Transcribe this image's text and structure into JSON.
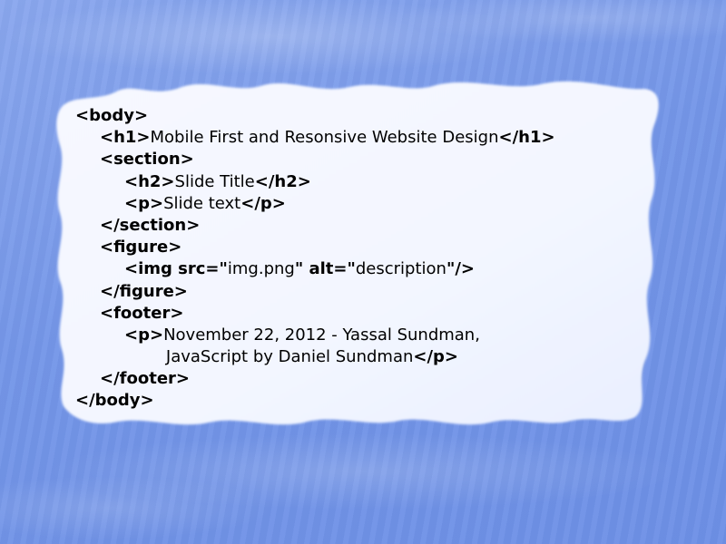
{
  "background": {
    "color": "#7a9ae9",
    "paper_color": "#f4f7ff"
  },
  "code_lines": [
    {
      "indent": 0,
      "parts": [
        {
          "text": "<body>",
          "bold": true
        }
      ]
    },
    {
      "indent": 1,
      "parts": [
        {
          "text": "<h1>",
          "bold": true
        },
        {
          "text": "Mobile First and Resonsive Website Design",
          "bold": false
        },
        {
          "text": "</h1>",
          "bold": true
        }
      ]
    },
    {
      "indent": 1,
      "parts": [
        {
          "text": "<section>",
          "bold": true
        }
      ]
    },
    {
      "indent": 2,
      "parts": [
        {
          "text": "<h2>",
          "bold": true
        },
        {
          "text": "Slide Title",
          "bold": false
        },
        {
          "text": "</h2>",
          "bold": true
        }
      ]
    },
    {
      "indent": 2,
      "parts": [
        {
          "text": "<p>",
          "bold": true
        },
        {
          "text": "Slide text",
          "bold": false
        },
        {
          "text": "</p>",
          "bold": true
        }
      ]
    },
    {
      "indent": 1,
      "parts": [
        {
          "text": "</section>",
          "bold": true
        }
      ]
    },
    {
      "indent": 1,
      "parts": [
        {
          "text": "<figure>",
          "bold": true
        }
      ]
    },
    {
      "indent": 2,
      "parts": [
        {
          "text": "<img src=\"",
          "bold": true
        },
        {
          "text": "img.png",
          "bold": false
        },
        {
          "text": "\" alt=\"",
          "bold": true
        },
        {
          "text": "description",
          "bold": false
        },
        {
          "text": "\"/>",
          "bold": true
        }
      ]
    },
    {
      "indent": 1,
      "parts": [
        {
          "text": "</figure>",
          "bold": true
        }
      ]
    },
    {
      "indent": 1,
      "parts": [
        {
          "text": "<footer>",
          "bold": true
        }
      ]
    },
    {
      "indent": 2,
      "parts": [
        {
          "text": "<p>",
          "bold": true
        },
        {
          "text": "November 22, 2012 - Yassal Sundman,",
          "bold": false
        }
      ]
    },
    {
      "indent": 3.7,
      "parts": [
        {
          "text": "JavaScript by Daniel Sundman",
          "bold": false
        },
        {
          "text": "</p>",
          "bold": true
        }
      ]
    },
    {
      "indent": 1,
      "parts": [
        {
          "text": "</footer>",
          "bold": true
        }
      ]
    },
    {
      "indent": 0,
      "parts": [
        {
          "text": "</body>",
          "bold": true
        }
      ]
    }
  ]
}
